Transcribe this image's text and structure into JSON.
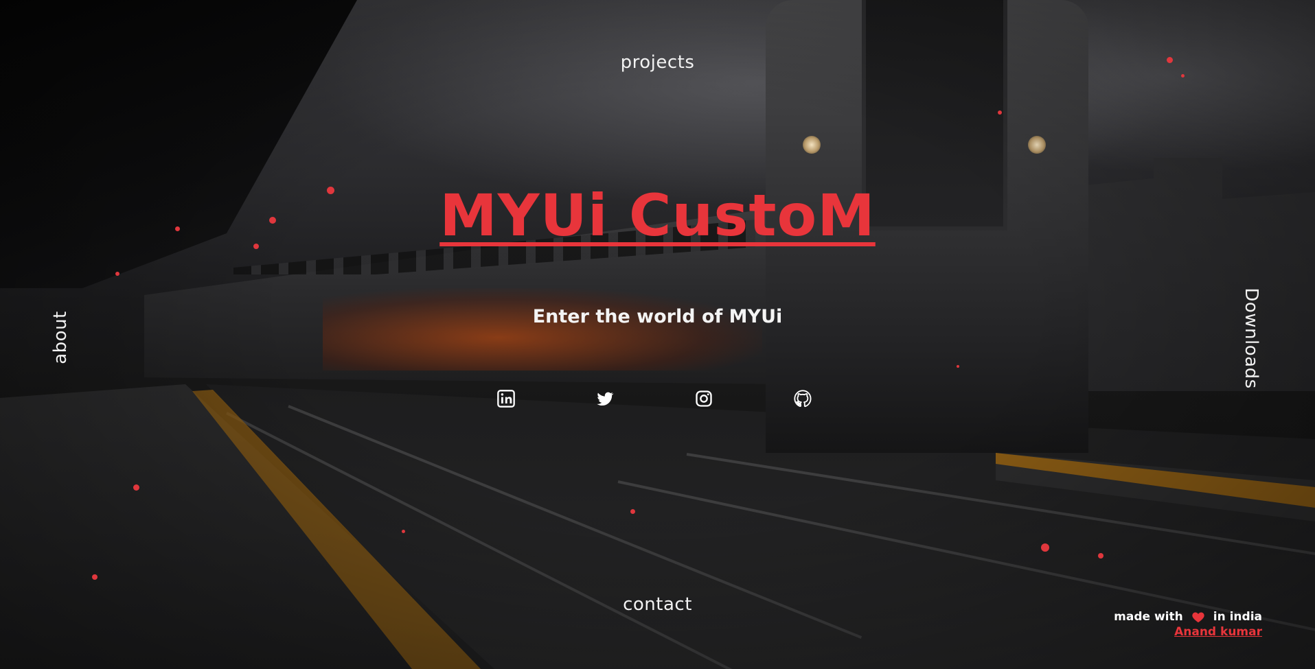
{
  "nav": {
    "top": "projects",
    "bottom": "contact",
    "left": "about",
    "right": "Downloads"
  },
  "hero": {
    "title": "MYUi CustoM",
    "subtitle": "Enter the world of MYUi"
  },
  "socials": [
    {
      "icon": "linkedin-icon"
    },
    {
      "icon": "twitter-icon"
    },
    {
      "icon": "instagram-icon"
    },
    {
      "icon": "github-icon"
    }
  ],
  "footer": {
    "made_with": "made with",
    "in_india": "in india",
    "author": "Anand kumar"
  },
  "colors": {
    "accent": "#e8353b",
    "text": "#f2f2f2"
  }
}
